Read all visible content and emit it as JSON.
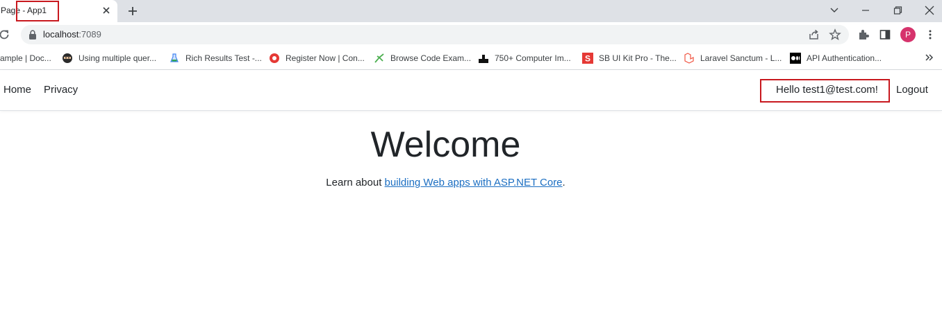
{
  "browser": {
    "tab": {
      "title": "Page - App1"
    },
    "address_bar": {
      "host": "localhost",
      "port": ":7089"
    },
    "profile_initial": "P",
    "bookmarks": [
      {
        "label": "ample | Doc...",
        "icon": "document-icon"
      },
      {
        "label": "Using multiple quer...",
        "icon": "ninja-icon"
      },
      {
        "label": "Rich Results Test -...",
        "icon": "google-flask-icon"
      },
      {
        "label": "Register Now | Con...",
        "icon": "red-circle-icon"
      },
      {
        "label": "Browse Code Exam...",
        "icon": "grasshopper-icon"
      },
      {
        "label": "750+ Computer Im...",
        "icon": "building-icon"
      },
      {
        "label": "SB UI Kit Pro - The...",
        "icon": "sb-logo-icon"
      },
      {
        "label": "Laravel Sanctum - L...",
        "icon": "laravel-icon"
      },
      {
        "label": "API Authentication...",
        "icon": "medium-icon"
      }
    ]
  },
  "site": {
    "nav": {
      "home": "Home",
      "privacy": "Privacy",
      "greeting": "Hello test1@test.com!",
      "logout": "Logout"
    },
    "heading": "Welcome",
    "lead_prefix": "Learn about ",
    "lead_link": "building Web apps with ASP.NET Core",
    "lead_suffix": "."
  },
  "colors": {
    "highlight_box": "#c8181e",
    "link": "#1b6ec2",
    "avatar": "#d6336c"
  }
}
